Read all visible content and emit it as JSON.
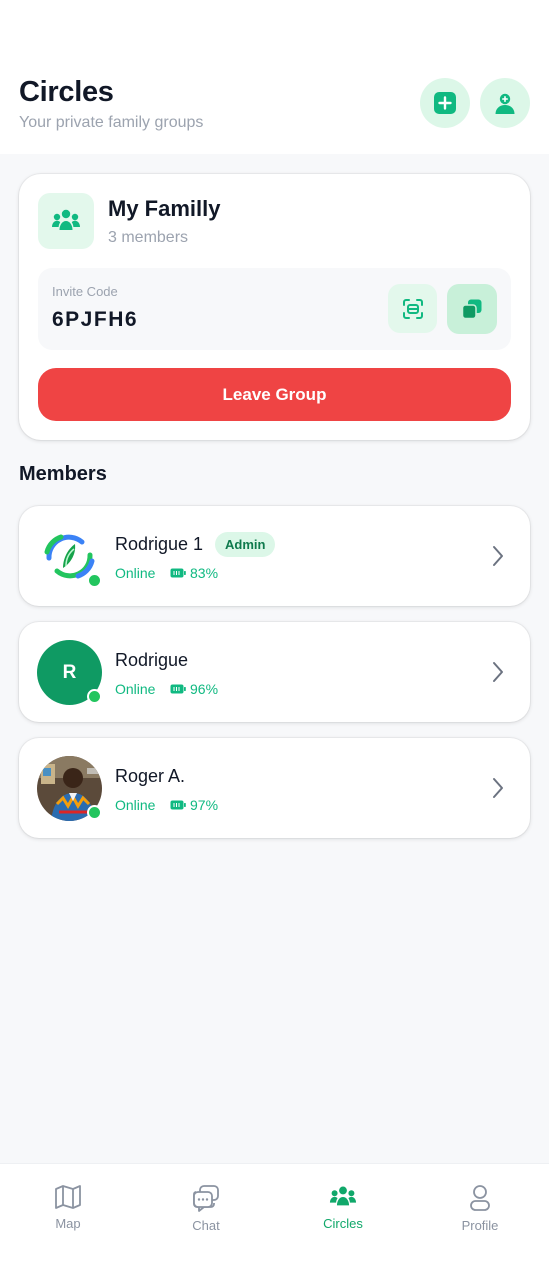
{
  "header": {
    "title": "Circles",
    "subtitle": "Your private family groups"
  },
  "group": {
    "name": "My Familly",
    "member_count": "3 members",
    "invite_label": "Invite Code",
    "invite_code": "6PJFH6",
    "leave_label": "Leave Group"
  },
  "members_heading": "Members",
  "members": [
    {
      "name": "Rodrigue 1",
      "badge": "Admin",
      "status": "Online",
      "battery": "83%",
      "avatar": "logo"
    },
    {
      "name": "Rodrigue",
      "initial": "R",
      "status": "Online",
      "battery": "96%",
      "avatar": "letter"
    },
    {
      "name": "Roger A.",
      "status": "Online",
      "battery": "97%",
      "avatar": "photo"
    }
  ],
  "nav": [
    {
      "label": "Map",
      "icon": "map-icon",
      "active": false
    },
    {
      "label": "Chat",
      "icon": "chat-icon",
      "active": false
    },
    {
      "label": "Circles",
      "icon": "circles-icon",
      "active": true
    },
    {
      "label": "Profile",
      "icon": "profile-icon",
      "active": false
    }
  ],
  "colors": {
    "accent": "#10b981",
    "accent_dark": "#0f9a63",
    "danger": "#ef4444",
    "light_green": "#dcf7e8"
  }
}
